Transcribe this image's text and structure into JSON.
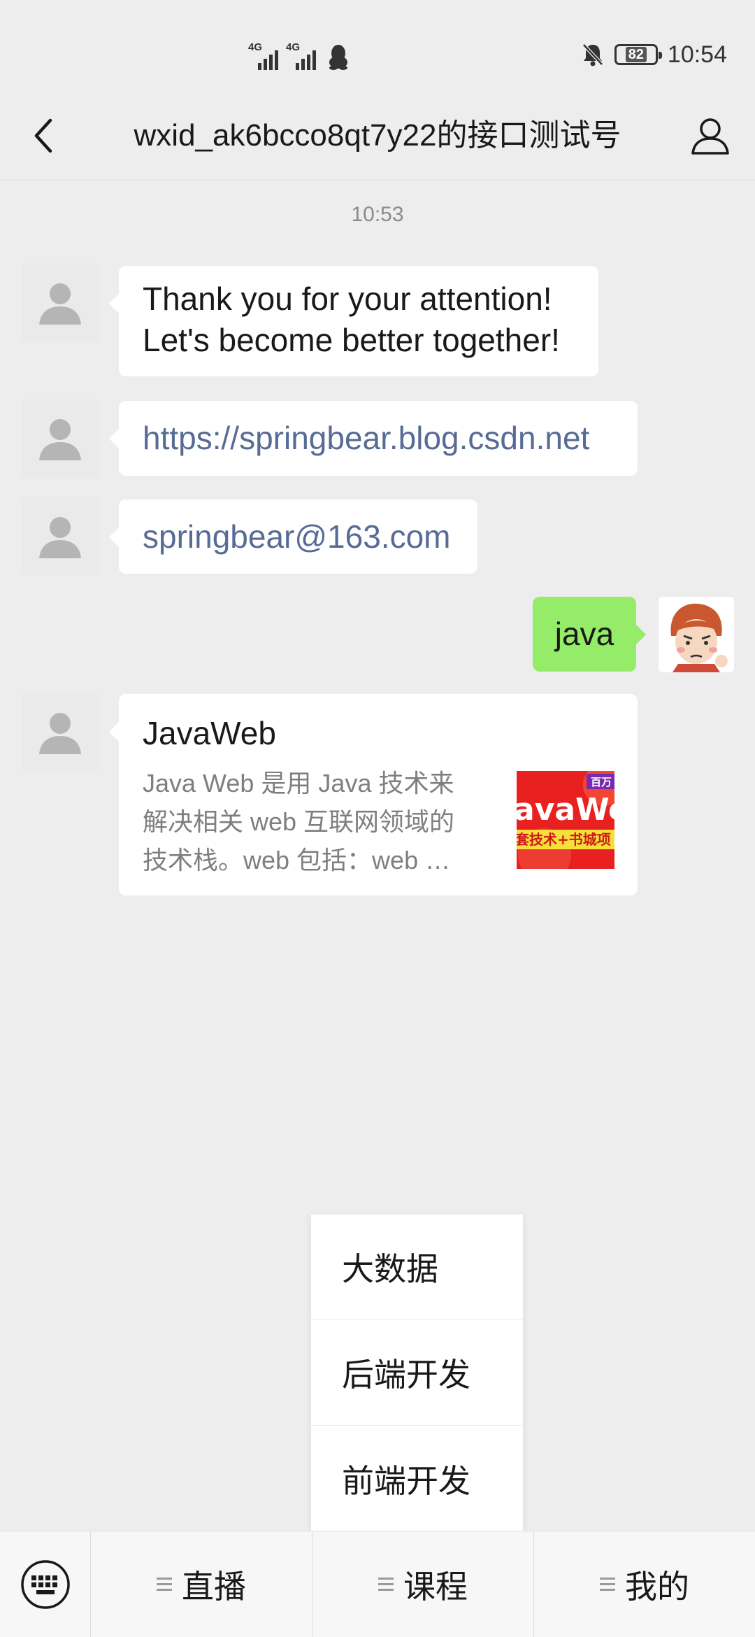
{
  "status_bar": {
    "network_1": "4G",
    "network_2": "4G",
    "battery": "82",
    "time": "10:54"
  },
  "header": {
    "title": "wxid_ak6bcco8qt7y22的接口测试号"
  },
  "chat": {
    "timestamp": "10:53",
    "messages": [
      {
        "from": "them",
        "lines": [
          "Thank you for your attention!",
          "Let's become better together!"
        ]
      },
      {
        "from": "them",
        "link": "https://springbear.blog.csdn.net"
      },
      {
        "from": "them",
        "link": "springbear@163.com"
      },
      {
        "from": "me",
        "text": "java"
      },
      {
        "from": "them",
        "card": {
          "title": "JavaWeb",
          "description": "Java Web 是用 Java 技术来解决相关 web 互联网领域的技术栈。web 包括：web …",
          "thumb_text_1": "百万",
          "thumb_text_2": "avaWe",
          "thumb_text_3": "套技术+书城项"
        }
      }
    ]
  },
  "popup_menu": {
    "items": [
      "大数据",
      "后端开发",
      "前端开发"
    ]
  },
  "bottom_bar": {
    "menus": [
      "直播",
      "课程",
      "我的"
    ]
  }
}
